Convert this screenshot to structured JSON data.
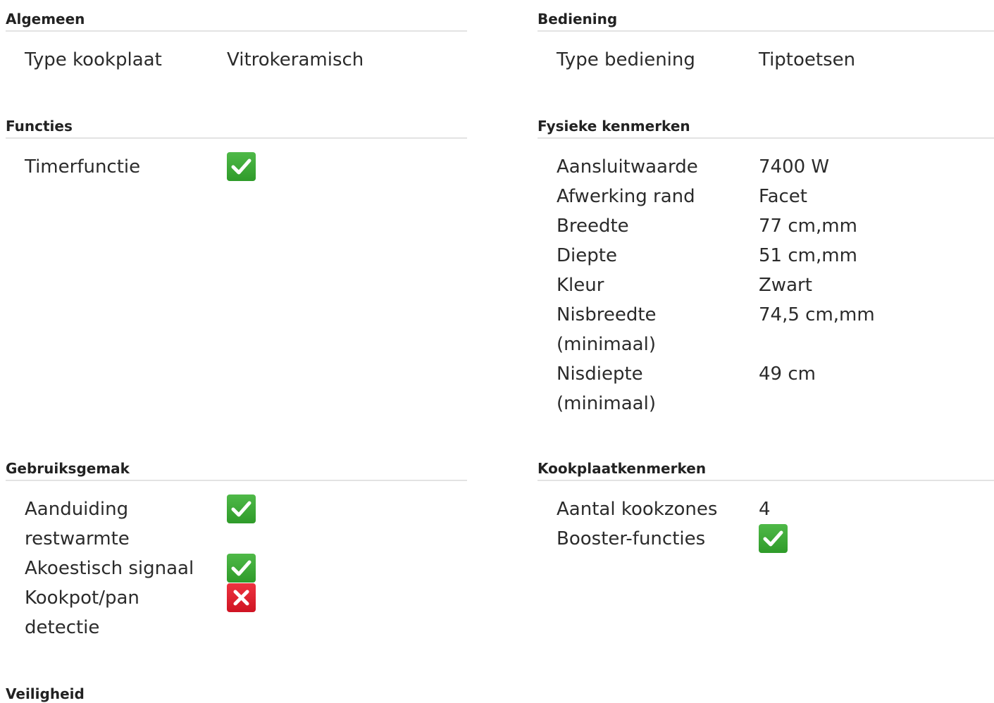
{
  "sections": {
    "algemeen": {
      "title": "Algemeen",
      "rows": [
        {
          "label": "Type kookplaat",
          "value": "Vitrokeramisch"
        }
      ]
    },
    "bediening": {
      "title": "Bediening",
      "rows": [
        {
          "label": "Type bediening",
          "value": "Tiptoetsen"
        }
      ]
    },
    "functies": {
      "title": "Functies",
      "rows": [
        {
          "label": "Timerfunctie",
          "icon": "check-icon"
        }
      ]
    },
    "fysieke": {
      "title": "Fysieke kenmerken",
      "rows": [
        {
          "label": "Aansluitwaarde",
          "value": "7400 W"
        },
        {
          "label": "Afwerking rand",
          "value": "Facet"
        },
        {
          "label": "Breedte",
          "value": "77 cm,mm"
        },
        {
          "label": "Diepte",
          "value": "51 cm,mm"
        },
        {
          "label": "Kleur",
          "value": "Zwart"
        },
        {
          "label": "Nisbreedte (minimaal)",
          "value": "74,5 cm,mm"
        },
        {
          "label": "Nisdiepte (minimaal)",
          "value": "49 cm"
        }
      ]
    },
    "gebruiksgemak": {
      "title": "Gebruiksgemak",
      "rows": [
        {
          "label": "Aanduiding restwarmte",
          "icon": "check-icon"
        },
        {
          "label": "Akoestisch signaal",
          "icon": "check-icon"
        },
        {
          "label": "Kookpot/pan detectie",
          "icon": "cross-icon"
        }
      ]
    },
    "kookplaat": {
      "title": "Kookplaatkenmerken",
      "rows": [
        {
          "label": "Aantal kookzones",
          "value": "4"
        },
        {
          "label": "Booster-functies",
          "icon": "check-icon"
        }
      ]
    },
    "veiligheid": {
      "title": "Veiligheid"
    }
  },
  "colors": {
    "check": "#3aa833",
    "cross": "#e21b2a",
    "divider": "#e3e3e3"
  }
}
